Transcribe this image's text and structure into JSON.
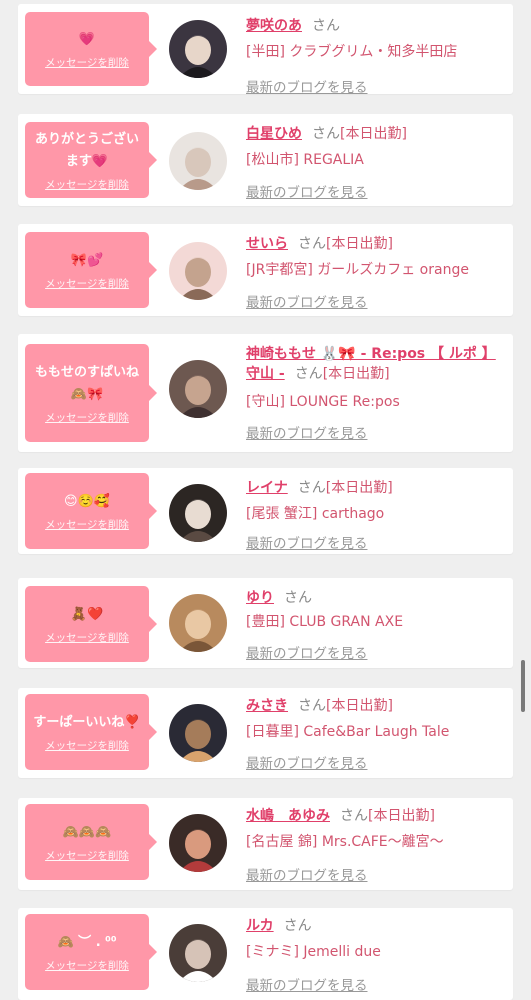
{
  "delete_label": "メッセージを削除",
  "blog_label": "最新のブログを見る",
  "honorific": "さん",
  "colors": {
    "bubble": "#ff97a8",
    "name": "#e0406a",
    "shop": "#d2556f",
    "background": "#efefef"
  },
  "messages": [
    {
      "message": "💗",
      "name": "夢咲のあ",
      "tag": "",
      "shop": "[半田] クラブグリム・知多半田店",
      "avatar_icon": "avatar-icon"
    },
    {
      "message": "ありがとうございます💗",
      "name": "白星ひめ",
      "tag": "[本日出勤]",
      "shop": "[松山市] REGALIA",
      "avatar_icon": "avatar-icon"
    },
    {
      "message": "🎀💕",
      "name": "せいら",
      "tag": "[本日出勤]",
      "shop": "[JR宇都宮] ガールズカフェ orange",
      "avatar_icon": "avatar-icon"
    },
    {
      "message": "ももせのすぱいね🙈🎀",
      "name": "神崎ももせ 🐰🎀 - Re:pos 【 ルポ 】守山 -",
      "tag": "[本日出勤]",
      "shop": "[守山] LOUNGE Re:pos",
      "avatar_icon": "avatar-icon"
    },
    {
      "message": "😊☺️🥰",
      "name": "レイナ",
      "tag": "[本日出勤]",
      "shop": "[尾張 蟹江] carthago",
      "avatar_icon": "avatar-icon"
    },
    {
      "message": "🧸❤️",
      "name": "ゆり",
      "tag": "",
      "shop": "[豊田] CLUB GRAN AXE",
      "avatar_icon": "avatar-icon"
    },
    {
      "message": "すーぱーいいね❣️",
      "name": "みさき",
      "tag": "[本日出勤]",
      "shop": "[日暮里] Cafe&Bar Laugh Tale",
      "avatar_icon": "avatar-icon"
    },
    {
      "message": "🙈🙈🙈",
      "name": "水嶋　あゆみ",
      "tag": "[本日出勤]",
      "shop": "[名古屋 錦] Mrs.CAFE〜離宮〜",
      "avatar_icon": "avatar-icon"
    },
    {
      "message": "🙈 ︶ . ⁰⁰",
      "name": "ルカ",
      "tag": "",
      "shop": "[ミナミ] Jemelli due",
      "avatar_icon": "avatar-icon"
    }
  ]
}
